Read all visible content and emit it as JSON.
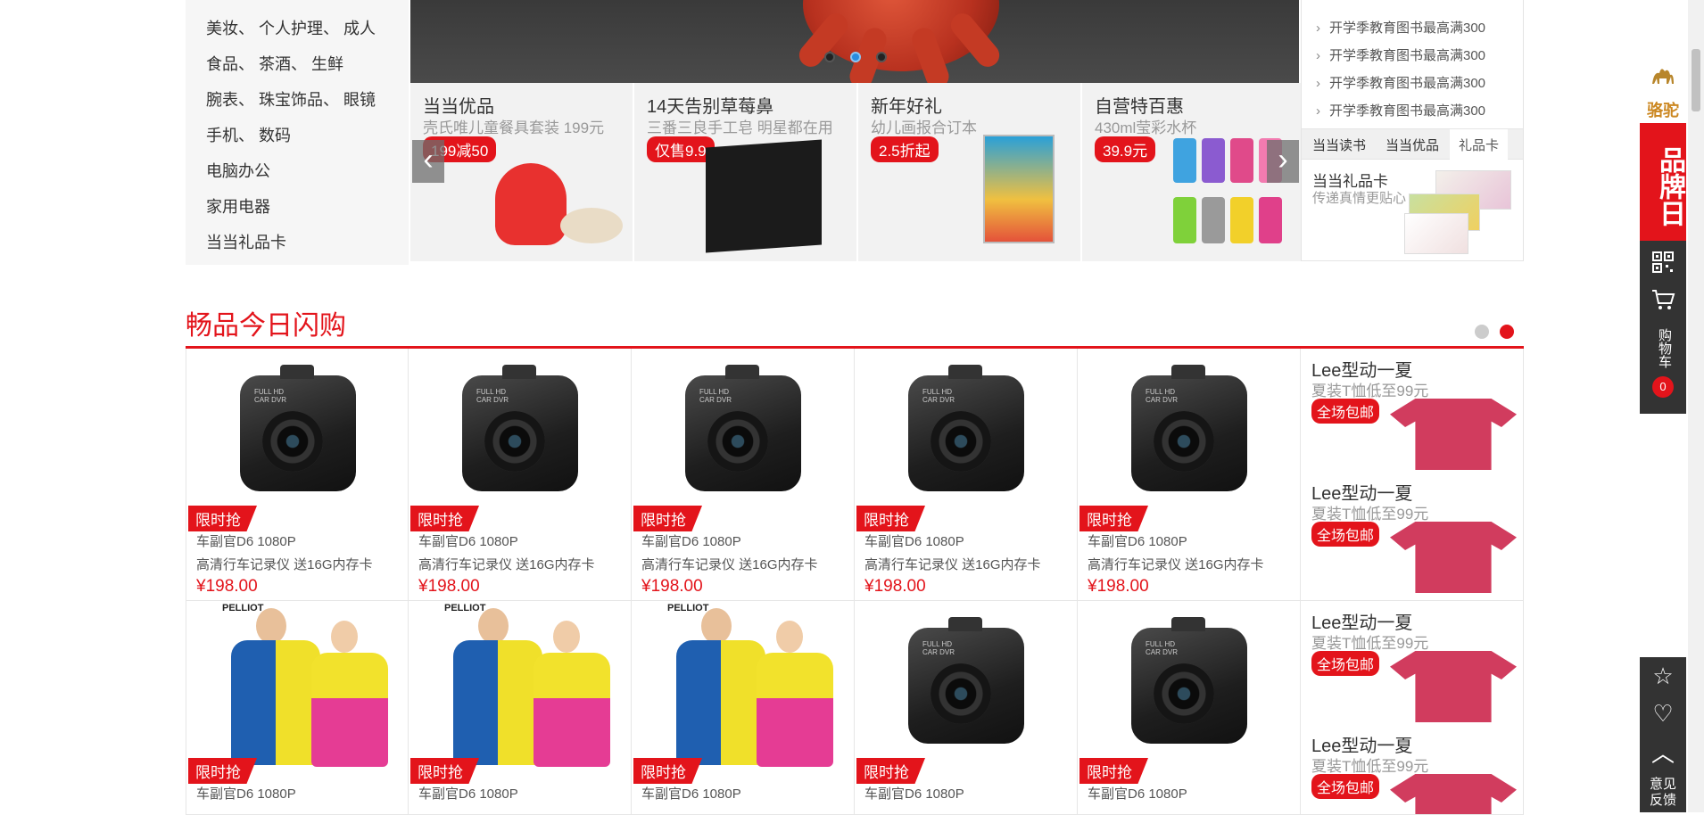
{
  "categories": [
    "美妆、 个人护理、 成人",
    "食品、 茶酒、 生鲜",
    "腕表、 珠宝饰品、 眼镜",
    "手机、 数码",
    "电脑办公",
    "家用电器",
    "当当礼品卡"
  ],
  "promos": [
    {
      "title": "当当优品",
      "sub": "壳氏唯儿童餐具套装 199元",
      "badge": "199减50"
    },
    {
      "title": "14天告别草莓鼻",
      "sub": "三番三良手工皂 明星都在用",
      "badge": "仅售9.9"
    },
    {
      "title": "新年好礼",
      "sub": "幼儿画报合订本",
      "badge": "2.5折起"
    },
    {
      "title": "自营特百惠",
      "sub": "430ml莹彩水杯",
      "badge": "39.9元"
    }
  ],
  "notices": [
    "开学季教育图书最高满300",
    "开学季教育图书最高满300",
    "开学季教育图书最高满300",
    "开学季教育图书最高满300"
  ],
  "gift_tabs": [
    "当当读书",
    "当当优品",
    "礼品卡"
  ],
  "gift_card": {
    "title": "当当礼品卡",
    "sub": "传递真情更贴心"
  },
  "section_title": "畅品今日闪购",
  "product": {
    "tag": "限时抢",
    "name1": "车副官D6 1080P",
    "name2": "高清行车记录仪 送16G内存卡",
    "price": "¥198.00"
  },
  "ad": {
    "title": "Lee型动一夏",
    "sub": "夏装T恤低至99元",
    "badge": "全场包邮"
  },
  "sidebar": {
    "brand_logo": "骆驼",
    "brand_day": "品牌日",
    "cart_label": "购物车",
    "cart_count": "0",
    "feedback": "意见反馈"
  },
  "icons": {
    "arrow_left": "‹",
    "arrow_right": "›",
    "star": "☆",
    "heart": "♡",
    "up": "︿"
  }
}
